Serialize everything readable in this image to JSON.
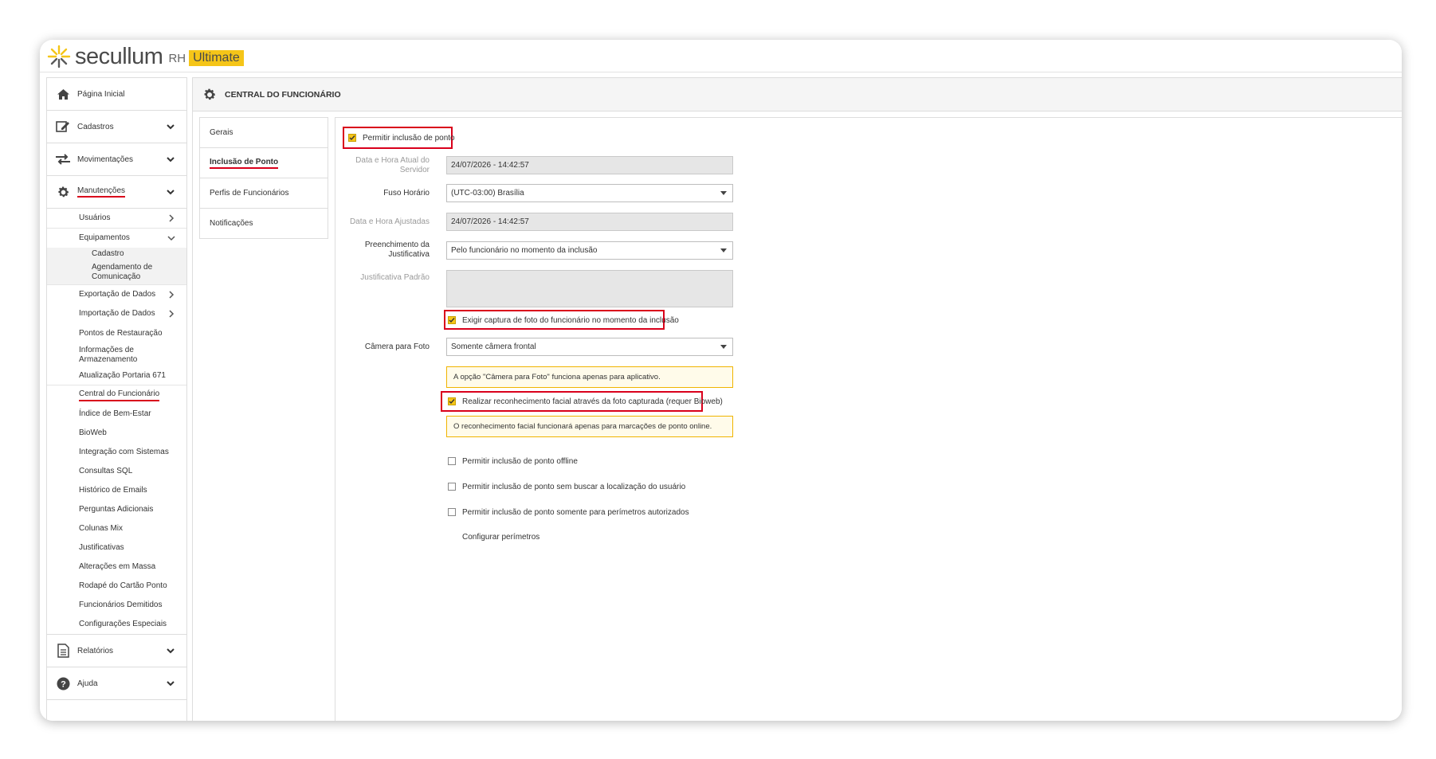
{
  "app": {
    "brand": "secullum",
    "product": "RH",
    "edition": "Ultimate"
  },
  "sidebar": {
    "items": [
      {
        "label": "Página Inicial",
        "icon": "home-icon"
      },
      {
        "label": "Cadastros",
        "icon": "edit-icon"
      },
      {
        "label": "Movimentações",
        "icon": "swap-icon"
      },
      {
        "label": "Manutenções",
        "icon": "gear-icon"
      },
      {
        "label": "Relatórios",
        "icon": "document-icon"
      },
      {
        "label": "Ajuda",
        "icon": "help-icon"
      }
    ],
    "manutencoes_sub": {
      "usuarios": "Usuários",
      "equipamentos": "Equipamentos",
      "cadastro": "Cadastro",
      "agendamento": "Agendamento de Comunicação",
      "exportacao": "Exportação de Dados",
      "importacao": "Importação de Dados",
      "pontos": "Pontos de Restauração",
      "informacoes": "Informações de Armazenamento",
      "atualizacao": "Atualização Portaria 671",
      "central": "Central do Funcionário",
      "indice": "Índice de Bem-Estar",
      "bioweb": "BioWeb",
      "integracao": "Integração com Sistemas",
      "consultas": "Consultas SQL",
      "historico": "Histórico de Emails",
      "perguntas": "Perguntas Adicionais",
      "colunas": "Colunas Mix",
      "justificativas": "Justificativas",
      "alteracoes": "Alterações em Massa",
      "rodape": "Rodapé do Cartão Ponto",
      "demitidos": "Funcionários Demitidos",
      "configuracoes": "Configurações Especiais"
    }
  },
  "main": {
    "title": "CENTRAL DO FUNCIONÁRIO",
    "tabs": [
      "Gerais",
      "Inclusão de Ponto",
      "Perfis de Funcionários",
      "Notificações"
    ],
    "form": {
      "permitir_inclusao": "Permitir inclusão de ponto",
      "data_servidor_label": "Data e Hora Atual do Servidor",
      "data_servidor_value": "24/07/2026 - 14:42:57",
      "fuso_label": "Fuso Horário",
      "fuso_value": "(UTC-03:00) Brasília",
      "data_ajustada_label": "Data e Hora Ajustadas",
      "data_ajustada_value": "24/07/2026 - 14:42:57",
      "preenchimento_label": "Preenchimento da Justificativa",
      "preenchimento_value": "Pelo funcionário no momento da inclusão",
      "justificativa_label": "Justificativa Padrão",
      "exigir_foto": "Exigir captura de foto do funcionário no momento da inclusão",
      "camera_label": "Câmera para Foto",
      "camera_value": "Somente câmera frontal",
      "camera_notice": "A opção \"Câmera para Foto\" funciona apenas para aplicativo.",
      "reconhecimento": "Realizar reconhecimento facial através da foto capturada (requer Bioweb)",
      "reconhecimento_notice": "O reconhecimento facial funcionará apenas para marcações de ponto online.",
      "offline": "Permitir inclusão de ponto offline",
      "sem_localizacao": "Permitir inclusão de ponto sem buscar a localização do usuário",
      "perimetros": "Permitir inclusão de ponto somente para perímetros autorizados",
      "configurar_perimetros": "Configurar perímetros"
    }
  },
  "colors": {
    "accent": "#f5c518",
    "highlight": "#d9001b"
  }
}
